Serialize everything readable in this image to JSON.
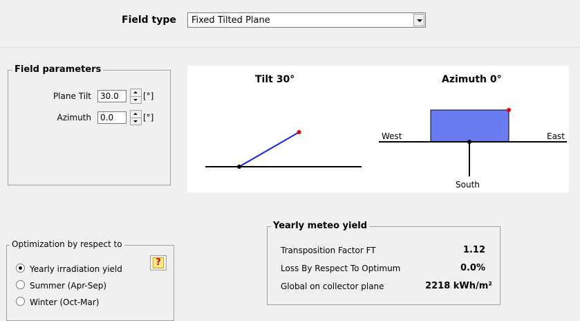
{
  "field_type": {
    "label": "Field type",
    "selected": "Fixed Tilted Plane"
  },
  "field_parameters": {
    "title": "Field parameters",
    "plane_tilt": {
      "label": "Plane Tilt",
      "value": "30.0",
      "unit": "[°]"
    },
    "azimuth": {
      "label": "Azimuth",
      "value": "0.0",
      "unit": "[°]"
    }
  },
  "diagram": {
    "tilt_title": "Tilt 30°",
    "azimuth_title": "Azimuth 0°",
    "west": "West",
    "east": "East",
    "south": "South",
    "tilt_deg": 30,
    "azimuth_deg": 0,
    "plane_color": "#6b7cf0",
    "line_color": "#1b26d6",
    "marker_color": "#e00000"
  },
  "optimization": {
    "title": "Optimization by respect to",
    "options": [
      "Yearly irradiation yield",
      "Summer (Apr-Sep)",
      "Winter (Oct-Mar)"
    ],
    "selected_index": 0,
    "help_icon": "?"
  },
  "meteo_yield": {
    "title": "Yearly meteo yield",
    "rows": [
      {
        "label": "Transposition Factor FT",
        "value": "1.12"
      },
      {
        "label": "Loss By Respect To Optimum",
        "value": "0.0%"
      },
      {
        "label": "Global on collector plane",
        "value": "2218 kWh/m²"
      }
    ]
  }
}
